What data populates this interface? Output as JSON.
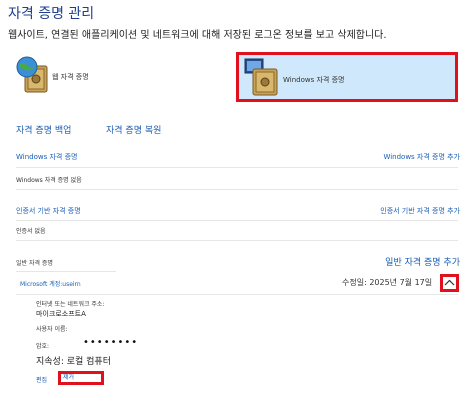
{
  "header": {
    "title": "자격 증명 관리",
    "subtitle": "웹사이트, 연결된 애플리케이션 및 네트워크에 대해 저장된 로그온 정보를 보고 삭제합니다."
  },
  "vaults": {
    "web_label": "웹 자격 증명",
    "windows_label": "Windows 자격 증명"
  },
  "actions": {
    "backup": "자격 증명 백업",
    "restore": "자격 증명 복원"
  },
  "windows_section": {
    "title": "Windows 자격 증명",
    "add": "Windows 자격 증명 추가",
    "empty": "Windows 자격 증명 없음"
  },
  "cert_section": {
    "title": "인증서 기반 자격 증명",
    "add": "인증서 기반 자격 증명 추가",
    "empty": "인증서 없음"
  },
  "generic_section": {
    "title": "일반 자격 증명",
    "add": "일반 자격 증명 추가"
  },
  "credential": {
    "name": "Microsoft 계정:useirn",
    "modified": "수정일: 2025년 7월 17일",
    "address_label": "인터넷 또는 네트워크 주소:",
    "address_value": "마이크로소프트A",
    "username_label": "사용자 이름:",
    "password_label": "암호:",
    "password_value": "••••••••",
    "persistence": "지속성: 로컬 컴퓨터",
    "edit": "편집",
    "remove": "제거"
  },
  "colors": {
    "accent": "#1a5fb4",
    "highlight": "#e0101c",
    "selected_bg": "#cfe8fb"
  },
  "icons": {
    "web_vault": "globe-safe-icon",
    "windows_vault": "monitor-safe-icon",
    "collapse": "chevron-up-icon"
  }
}
